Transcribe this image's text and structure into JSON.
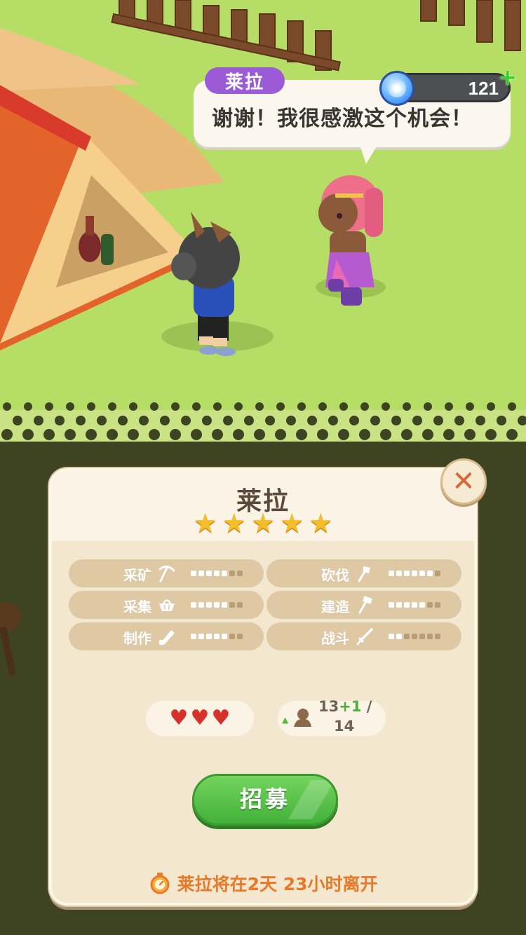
{
  "hud": {
    "currency_amount": "121",
    "currency_add": "+"
  },
  "dialogue": {
    "speaker": "莱拉",
    "text": "谢谢！我很感激这个机会！"
  },
  "panel": {
    "title": "莱拉",
    "star_count": 5,
    "stars": [
      "★",
      "★",
      "★",
      "★",
      "★"
    ],
    "close_glyph": "✕",
    "skills": [
      {
        "label": "采矿",
        "icon": "pickaxe-icon",
        "filled": 5,
        "total": 7
      },
      {
        "label": "砍伐",
        "icon": "axe-icon",
        "filled": 6,
        "total": 7
      },
      {
        "label": "采集",
        "icon": "basket-icon",
        "filled": 5,
        "total": 7
      },
      {
        "label": "建造",
        "icon": "hammer-icon",
        "filled": 5,
        "total": 7
      },
      {
        "label": "制作",
        "icon": "saw-icon",
        "filled": 5,
        "total": 7
      },
      {
        "label": "战斗",
        "icon": "sword-icon",
        "filled": 2,
        "total": 7
      }
    ],
    "hearts": [
      "♥",
      "♥",
      "♥"
    ],
    "population": {
      "arrow": "▲",
      "current": "13",
      "bonus": "+1",
      "separator": "/",
      "max": "14"
    },
    "recruit_label": "招募",
    "timer_text": "莱拉将在2天 23小时离开"
  },
  "colors": {
    "grass": "#b6dd65",
    "panel_bg": "#f4e7d0",
    "skill_pill": "#dfc9a5",
    "recruit_green": "#42b23a",
    "speaker_purple": "#9b5ad6",
    "timer_orange": "#e67a2a",
    "heart_red": "#d6322b",
    "star_gold": "#f4bd2c"
  }
}
